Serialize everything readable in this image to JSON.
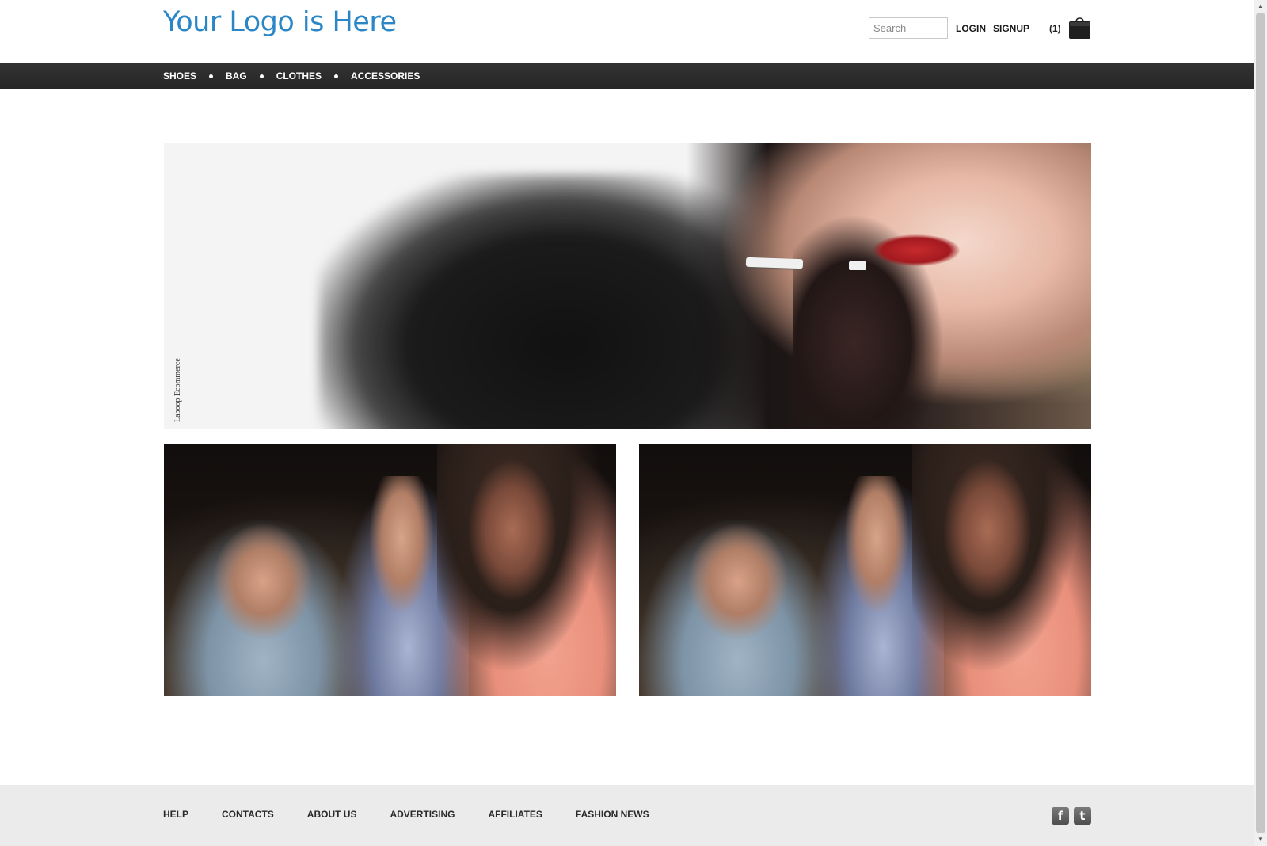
{
  "header": {
    "logo_text": "Your Logo is Here",
    "search_placeholder": "Search",
    "login_label": "LOGIN",
    "signup_label": "SIGNUP",
    "cart_count": "(1)",
    "cart_icon": "shopping-bag-icon",
    "logo_color": "#2b86c6"
  },
  "nav": {
    "items": [
      {
        "label": "SHOES"
      },
      {
        "label": "BAG"
      },
      {
        "label": "CLOTHES"
      },
      {
        "label": "ACCESSORIES"
      }
    ]
  },
  "hero": {
    "caption": "Laboop Ecommerce"
  },
  "footer": {
    "links": [
      {
        "label": "HELP"
      },
      {
        "label": "CONTACTS"
      },
      {
        "label": "ABOUT US"
      },
      {
        "label": "ADVERTISING"
      },
      {
        "label": "AFFILIATES"
      },
      {
        "label": "FASHION NEWS"
      }
    ],
    "social": [
      {
        "icon": "facebook-icon",
        "glyph": "f"
      },
      {
        "icon": "twitter-icon",
        "glyph": "t"
      }
    ]
  },
  "scrollbar": {
    "up_glyph": "▲",
    "down_glyph": "▼"
  }
}
